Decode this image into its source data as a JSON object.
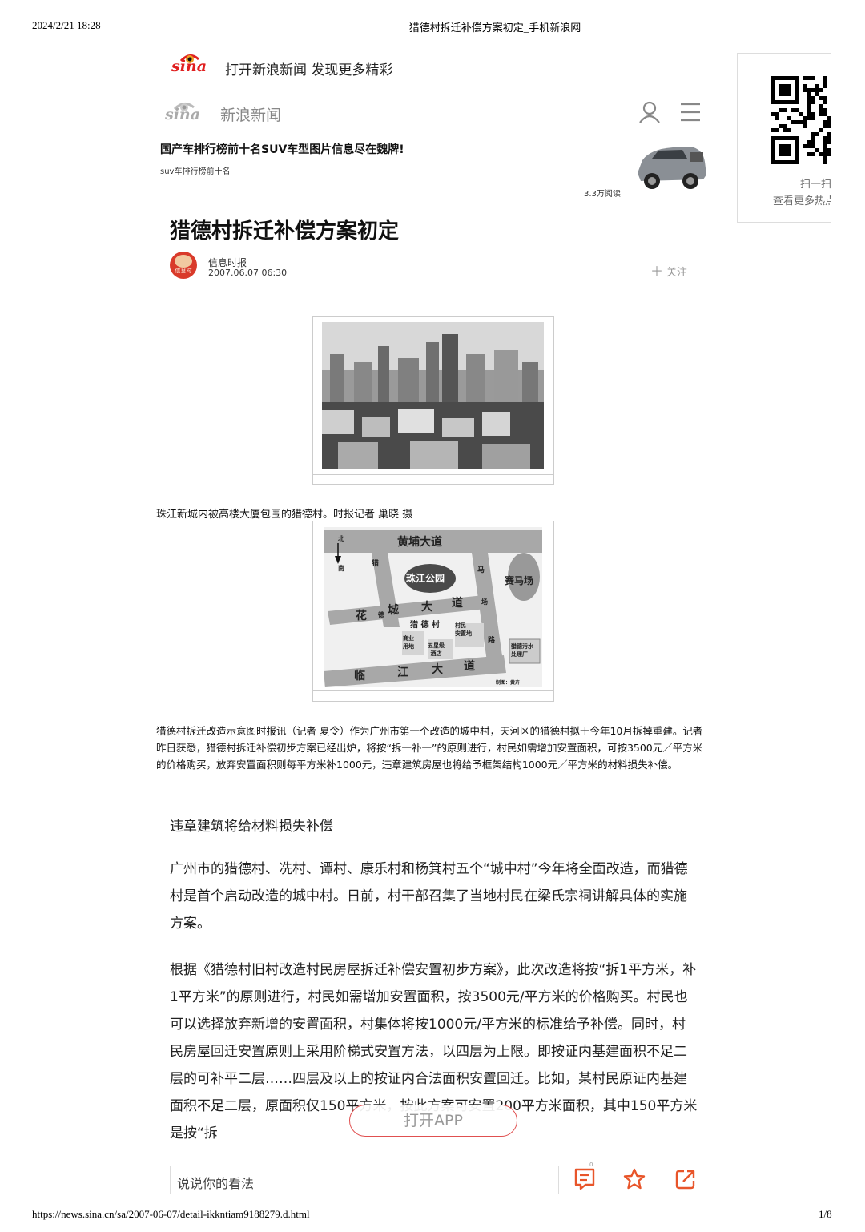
{
  "print_header": {
    "datetime": "2024/2/21 18:28",
    "page_title": "猎德村拆迁补偿方案初定_手机新浪网",
    "url": "https://news.sina.cn/sa/2007-06-07/detail-ikkntiam9188279.d.html",
    "page_number": "1/8"
  },
  "promo_banner": {
    "logo_text": "sina",
    "text": "打开新浪新闻 发现更多精彩"
  },
  "nav": {
    "logo_text": "sina",
    "title": "新浪新闻"
  },
  "ad": {
    "title": "国产车排行榜前十名SUV车型图片信息尽在魏牌!",
    "subtitle": "suv车排行榜前十名",
    "reads": "3.3万阅读"
  },
  "article": {
    "title": "猎德村拆迁补偿方案初定",
    "author": "信息时报",
    "avatar_text": "信息时",
    "date": "2007.06.07  06:30",
    "follow_label": "关注",
    "photo_caption": "珠江新城内被高楼大厦包围的猎德村。时报记者 巢晓 摄",
    "map": {
      "north": "北",
      "south": "南",
      "huangpu": "黄埔大道",
      "park": "珠江公园",
      "racecourse": "赛马场",
      "huacheng": [
        "花",
        "城",
        "大",
        "道"
      ],
      "lie": "猎",
      "de": "德",
      "ma": "马",
      "chang": "场",
      "lu": "路",
      "liedecun": "猎 德 村",
      "villager_land": "村民\n安置地",
      "commercial": "商业\n用地",
      "hotel": "五星级\n酒店",
      "sewage": "猎德污水\n处理厂",
      "linjiang": [
        "临",
        "江",
        "大",
        "道"
      ],
      "credit": "制图：黄卉"
    },
    "intro": "猎德村拆迁改造示意图时报讯（记者 夏令）作为广州市第一个改造的城中村，天河区的猎德村拟于今年10月拆掉重建。记者昨日获悉，猎德村拆迁补偿初步方案已经出炉，将按“拆一补一”的原则进行，村民如需增加安置面积，可按3500元／平方米的价格购买，放弃安置面积则每平方米补1000元，违章建筑房屋也将给予框架结构1000元／平方米的材料损失补偿。",
    "subhead": "违章建筑将给材料损失补偿",
    "para1": "广州市的猎德村、冼村、谭村、康乐村和杨箕村五个“城中村”今年将全面改造，而猎德村是首个启动改造的城中村。日前，村干部召集了当地村民在梁氏宗祠讲解具体的实施方案。",
    "para2": "根据《猎德村旧村改造村民房屋拆迁补偿安置初步方案》，此次改造将按“拆1平方米，补1平方米”的原则进行，村民如需增加安置面积，按3500元/平方米的价格购买。村民也可以选择放弃新增的安置面积，村集体将按1000元/平方米的标准给予补偿。同时，村民房屋回迁安置原则上采用阶梯式安置方法，以四层为上限。即按证内基建面积不足二层的可补平二层……四层及以上的按证内合法面积安置回迁。比如，某村民原证内基建面积不足二层，原面积仅150平方米，按此方案可安置200平方米面积，其中150平方米是按“拆"
  },
  "sidebar": {
    "qr_line1": "扫一扫",
    "qr_line2": "查看更多热点"
  },
  "bottom_bar": {
    "open_app": "打开APP",
    "comment_placeholder": "说说你的看法",
    "comment_count": "0"
  },
  "colors": {
    "brand_red": "#e02020",
    "accent_orange": "#e8552a"
  }
}
